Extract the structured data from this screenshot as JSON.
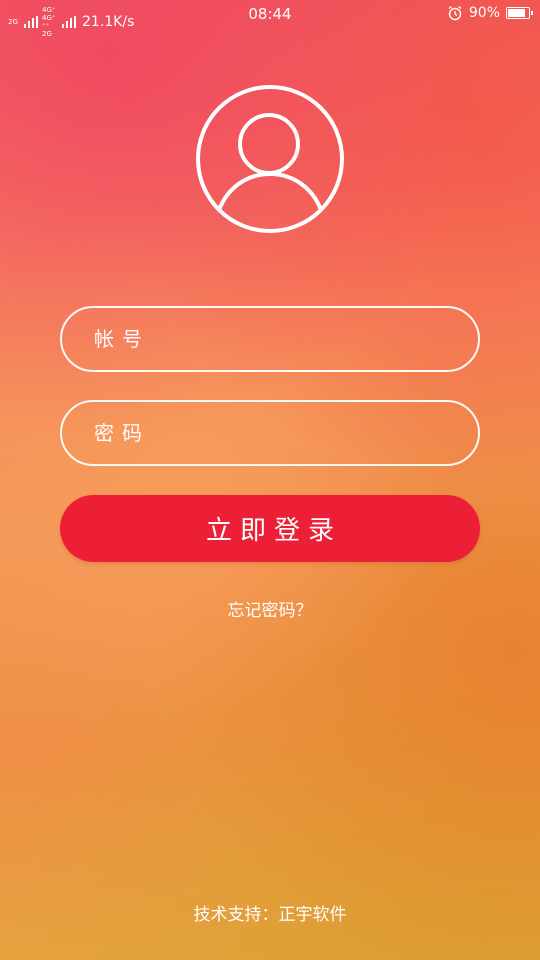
{
  "status_bar": {
    "sim1_tag": "2G",
    "sim2_tag_top": "4G⁺ 4G⁺",
    "sim2_tag_bottom": "⁺⁺ 2G",
    "net_speed": "21.1K/s",
    "time": "08:44",
    "battery_percent": "90%",
    "battery_level": 0.9,
    "alarm_icon": "alarm-clock-icon"
  },
  "login": {
    "avatar_icon": "user-avatar-icon",
    "account_placeholder": "帐号",
    "password_placeholder": "密码",
    "login_button": "立即登录",
    "forgot_password": "忘记密码？"
  },
  "footer": {
    "tech_support": "技术支持：正宇软件"
  },
  "colors": {
    "button": "#ec1f36",
    "text": "#ffffff",
    "field_border": "#ffffff"
  }
}
